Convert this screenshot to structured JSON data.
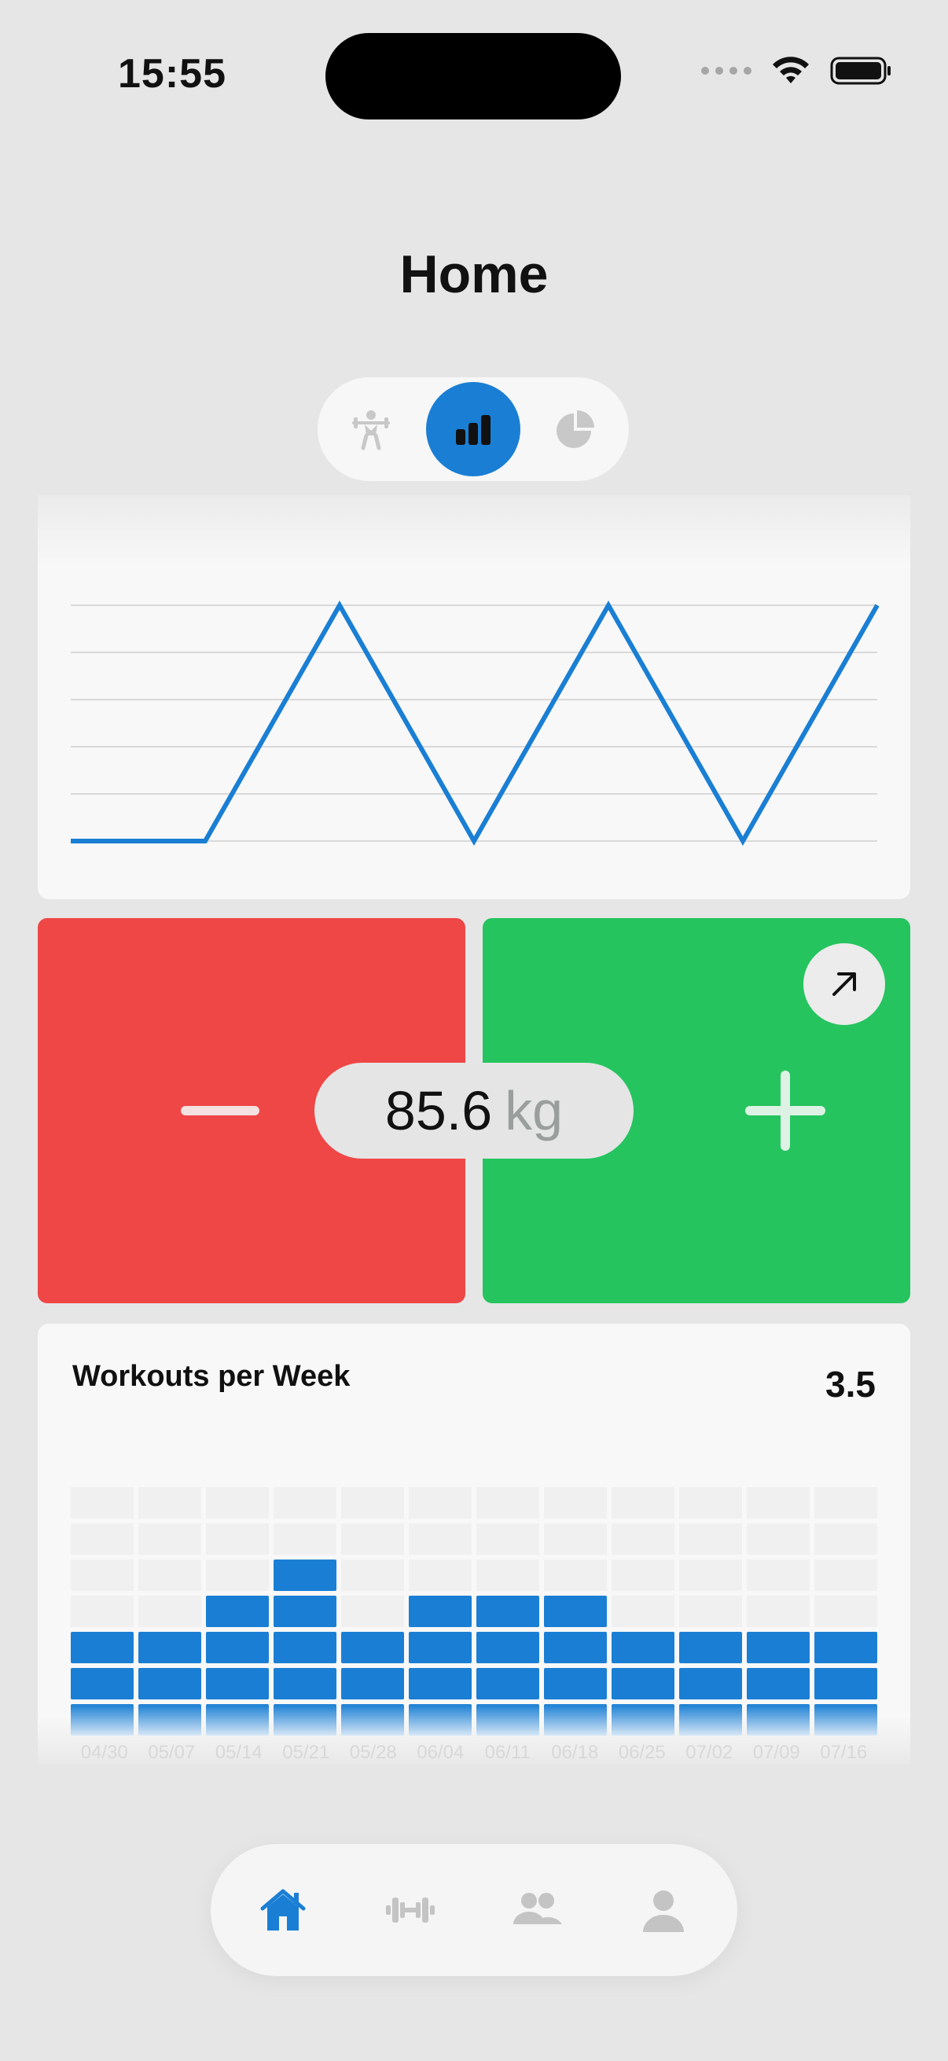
{
  "status_bar": {
    "time": "15:55"
  },
  "header": {
    "title": "Home"
  },
  "segmented": {
    "items": [
      {
        "icon": "weightlifter-icon",
        "active": false
      },
      {
        "icon": "bar-chart-icon",
        "active": true
      },
      {
        "icon": "pie-chart-icon",
        "active": false
      }
    ]
  },
  "weight": {
    "value": "85.6",
    "unit": "kg"
  },
  "workouts": {
    "title": "Workouts per Week",
    "value": "3.5"
  },
  "chart_data": [
    {
      "type": "line",
      "series": [
        {
          "values": [
            0,
            0,
            5,
            0,
            5,
            0,
            5
          ]
        }
      ],
      "ylim": [
        0,
        5
      ],
      "grid": true,
      "color": "#1a7fd4"
    },
    {
      "type": "bar",
      "title": "Workouts per Week",
      "categories": [
        "04/30",
        "05/07",
        "05/14",
        "05/21",
        "05/28",
        "06/04",
        "06/11",
        "06/18",
        "06/25",
        "07/02",
        "07/09",
        "07/16"
      ],
      "values": [
        3,
        3,
        4,
        5,
        3,
        4,
        4,
        4,
        3,
        3,
        3,
        3
      ],
      "ylim": [
        0,
        7
      ],
      "grid": true,
      "color": "#1a7fd4"
    }
  ],
  "tabbar": {
    "items": [
      {
        "icon": "home-icon",
        "active": true
      },
      {
        "icon": "dumbbell-icon",
        "active": false
      },
      {
        "icon": "friends-icon",
        "active": false
      },
      {
        "icon": "profile-icon",
        "active": false
      }
    ]
  },
  "colors": {
    "accent": "#1a7fd4",
    "minus": "#ef4646",
    "plus": "#25c45f"
  }
}
